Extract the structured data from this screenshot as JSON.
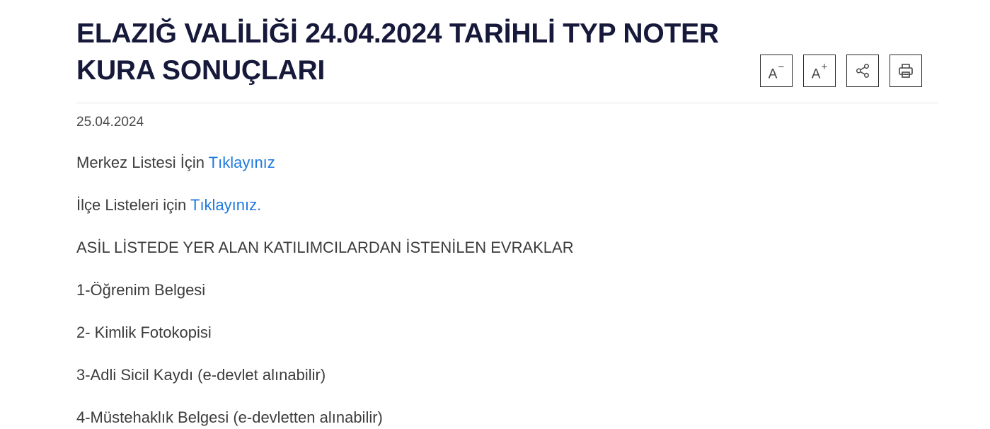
{
  "article": {
    "title": "ELAZIĞ VALİLİĞİ 24.04.2024 TARİHLİ TYP NOTER KURA SONUÇLARI",
    "date": "25.04.2024"
  },
  "tools": {
    "decrease_letter": "A",
    "decrease_symbol": "−",
    "increase_letter": "A",
    "increase_symbol": "+"
  },
  "content": {
    "merkez_text": "Merkez Listesi İçin ",
    "merkez_link": "Tıklayınız",
    "ilce_text": "İlçe Listeleri için ",
    "ilce_link": "Tıklayınız.",
    "docs_heading": "ASİL LİSTEDE YER ALAN KATILIMCILARDAN İSTENİLEN EVRAKLAR",
    "items": [
      "1-Öğrenim Belgesi",
      "2- Kimlik Fotokopisi",
      "3-Adli Sicil Kaydı (e-devlet alınabilir)",
      "4-Müstehaklık Belgesi (e-devletten alınabilir)"
    ]
  }
}
